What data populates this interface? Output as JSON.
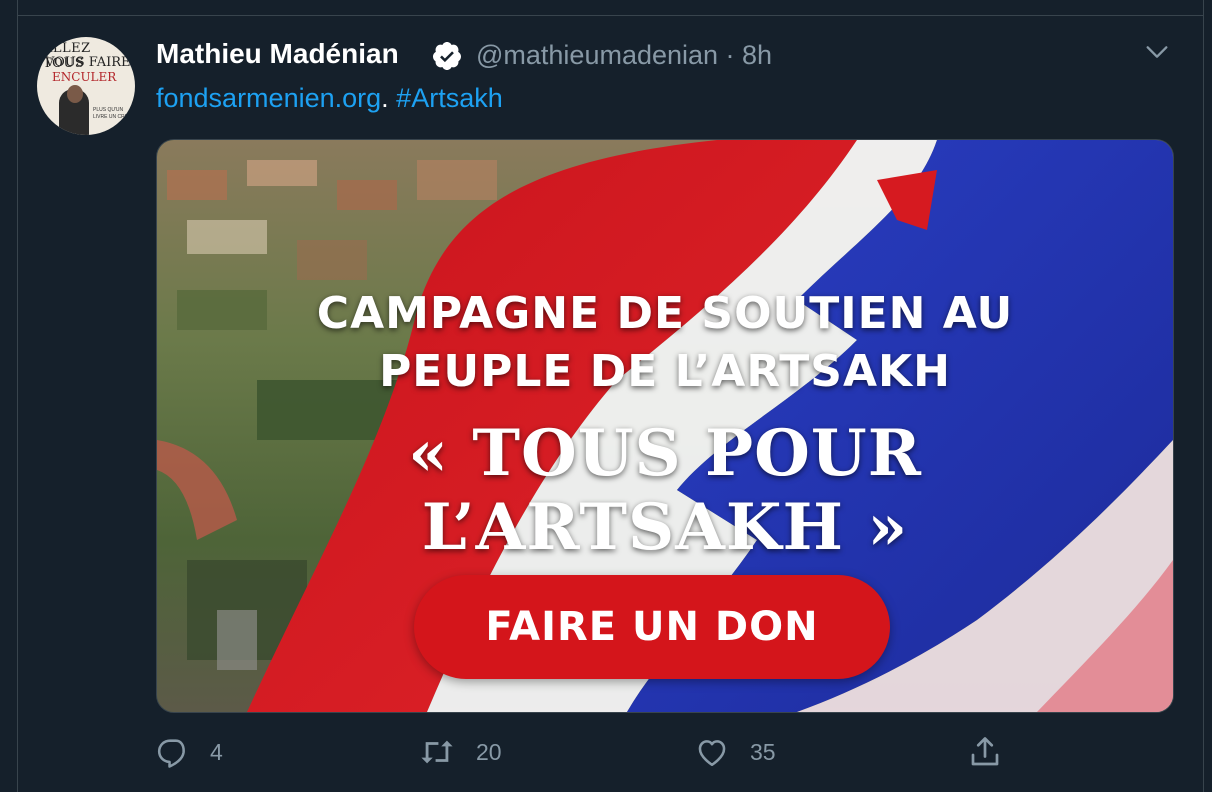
{
  "tweet": {
    "author_name": "Mathieu Madénian",
    "handle_time": "@mathieumadenian · 8h",
    "link_text": "fondsarmenien.org",
    "separator": ".",
    "hashtag": "#Artsakh"
  },
  "avatar": {
    "line1": "ALLEZ TOUS",
    "line2": "VOUS FAIRE",
    "line3": "ENCULER",
    "caption": "PLUS QU'UN LIVRE UN CRI."
  },
  "card": {
    "headline_line1": "CAMPAGNE DE SOUTIEN AU",
    "headline_line2": "PEUPLE DE L’ARTSAKH",
    "quote_line1": "« TOUS POUR",
    "quote_line2": "L’ARTSAKH »",
    "button_label": "FAIRE UN DON",
    "button_color": "#d4151b"
  },
  "actions": {
    "reply_count": "4",
    "retweet_count": "20",
    "like_count": "35"
  },
  "icons": [
    "verified-badge-icon",
    "chevron-down-icon",
    "reply-icon",
    "retweet-icon",
    "like-icon",
    "share-icon"
  ],
  "colors": {
    "background": "#15202b",
    "link": "#1da1f2",
    "secondary_text": "#8899a6",
    "border": "#38444d"
  }
}
